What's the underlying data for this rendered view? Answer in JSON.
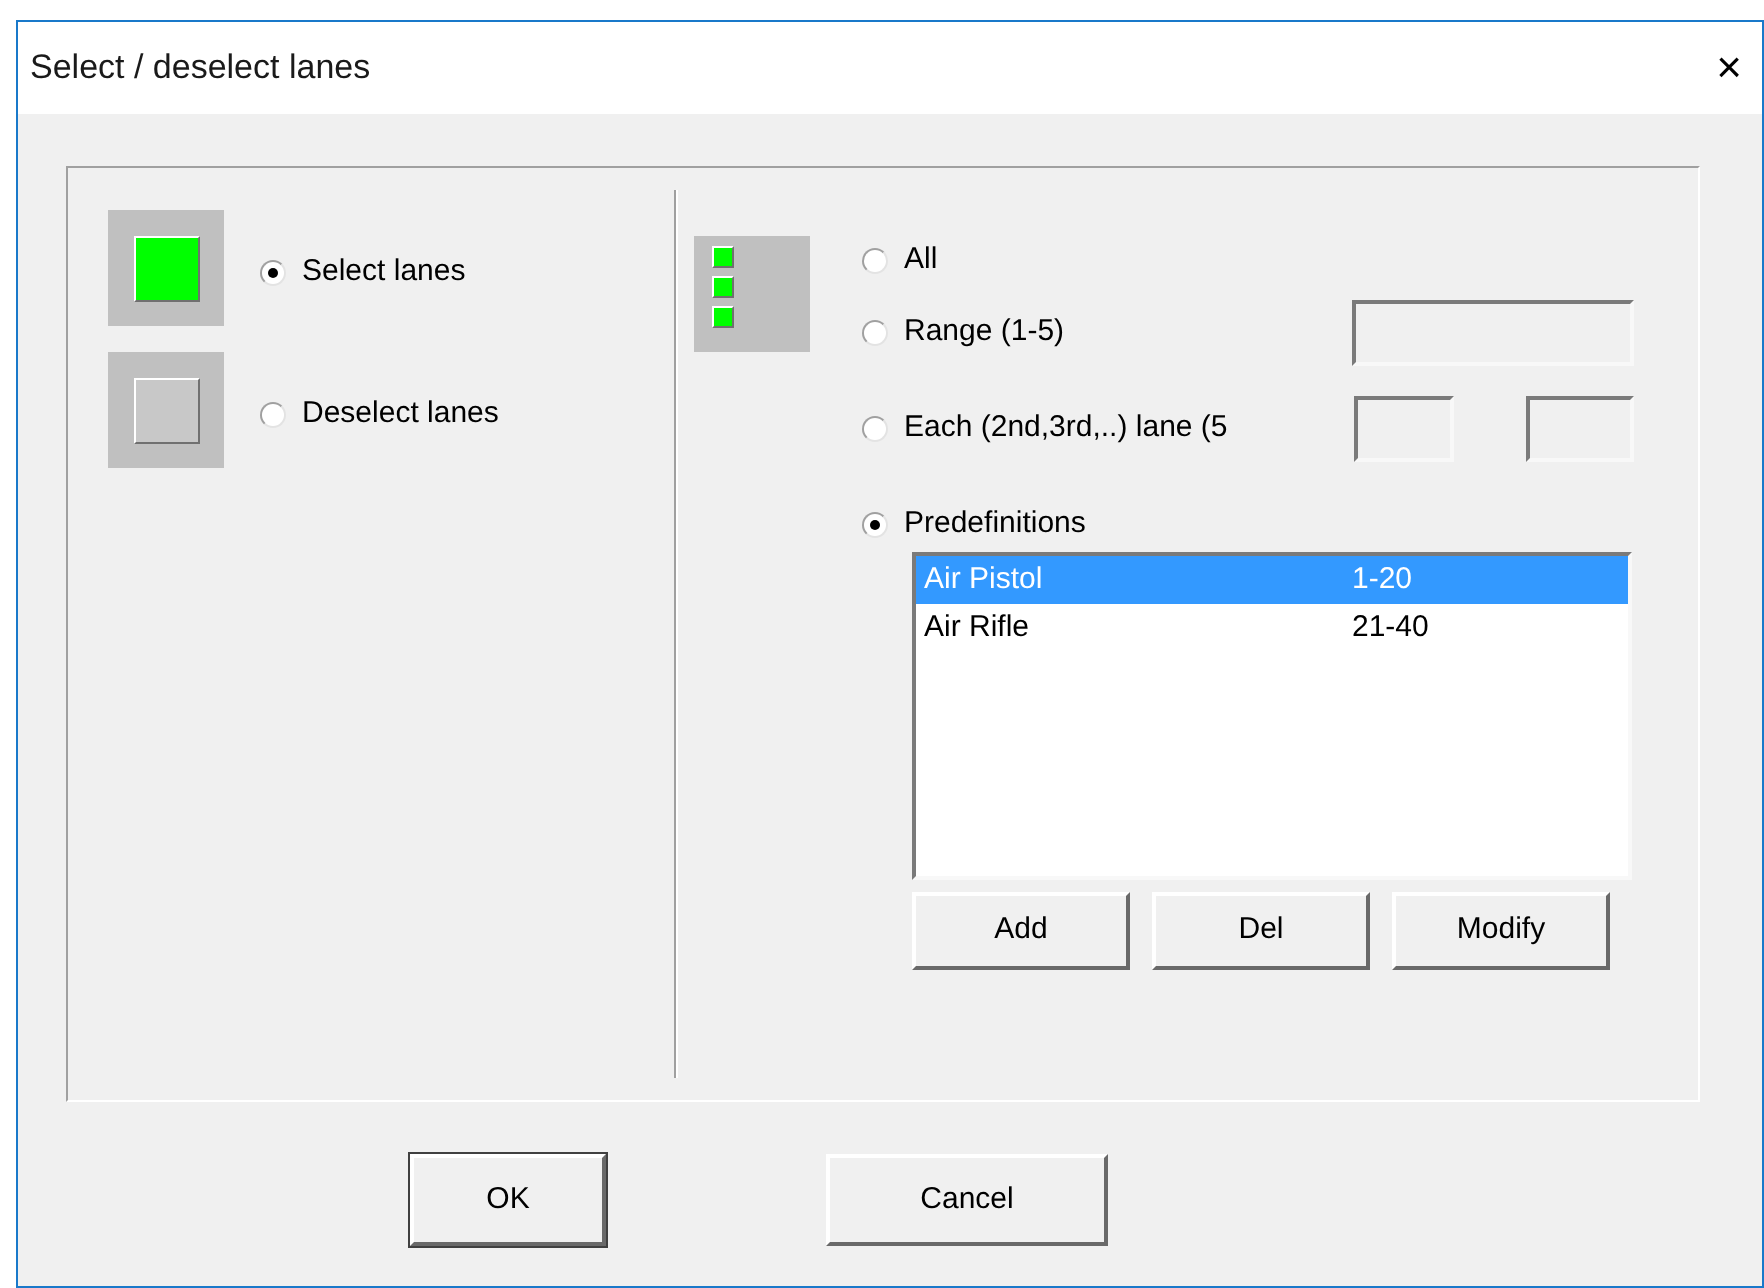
{
  "window": {
    "title": "Select / deselect lanes",
    "close": "×"
  },
  "mode_options": [
    {
      "label": "Select lanes",
      "selected": true,
      "kind": "select"
    },
    {
      "label": "Deselect lanes",
      "selected": false,
      "kind": "deselect"
    }
  ],
  "lane_options": [
    {
      "label": "All",
      "selected": false,
      "kind": "plain"
    },
    {
      "label": "Range (1-5)",
      "selected": false,
      "kind": "range"
    },
    {
      "label": "Each (2nd,3rd,..) lane (5",
      "selected": false,
      "kind": "each"
    },
    {
      "label": "Predefinitions",
      "selected": true,
      "kind": "list"
    }
  ],
  "predefinitions": [
    {
      "name": "Air Pistol",
      "lanes": "1-20",
      "selected": true
    },
    {
      "name": "Air Rifle",
      "lanes": "21-40",
      "selected": false
    }
  ],
  "list_buttons": [
    "Add",
    "Del",
    "Modify"
  ],
  "buttons": [
    {
      "label": "OK",
      "default": true
    },
    {
      "label": "Cancel",
      "default": false
    }
  ]
}
